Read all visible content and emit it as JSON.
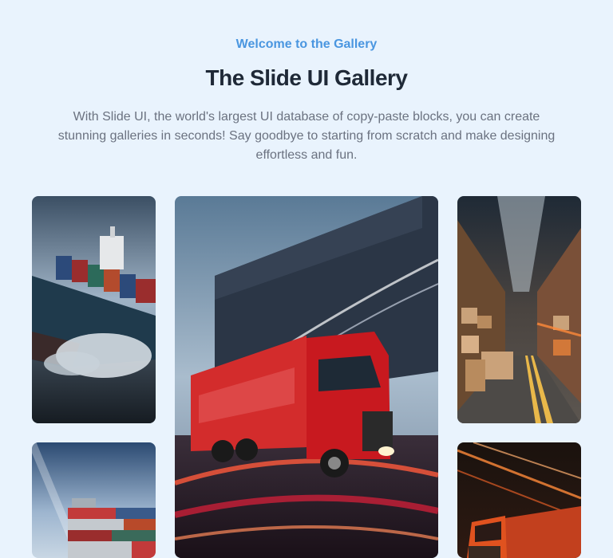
{
  "header": {
    "eyebrow": "Welcome to the Gallery",
    "title": "The Slide UI Gallery",
    "description": "With Slide UI, the world's largest UI database of copy-paste blocks, you can create stunning galleries in seconds! Say goodbye to starting from scratch and make designing effortless and fun."
  },
  "gallery": {
    "images": [
      {
        "name": "container-ship-image"
      },
      {
        "name": "red-truck-image"
      },
      {
        "name": "warehouse-image"
      },
      {
        "name": "shipping-containers-image"
      },
      {
        "name": "orange-truck-image"
      }
    ]
  }
}
